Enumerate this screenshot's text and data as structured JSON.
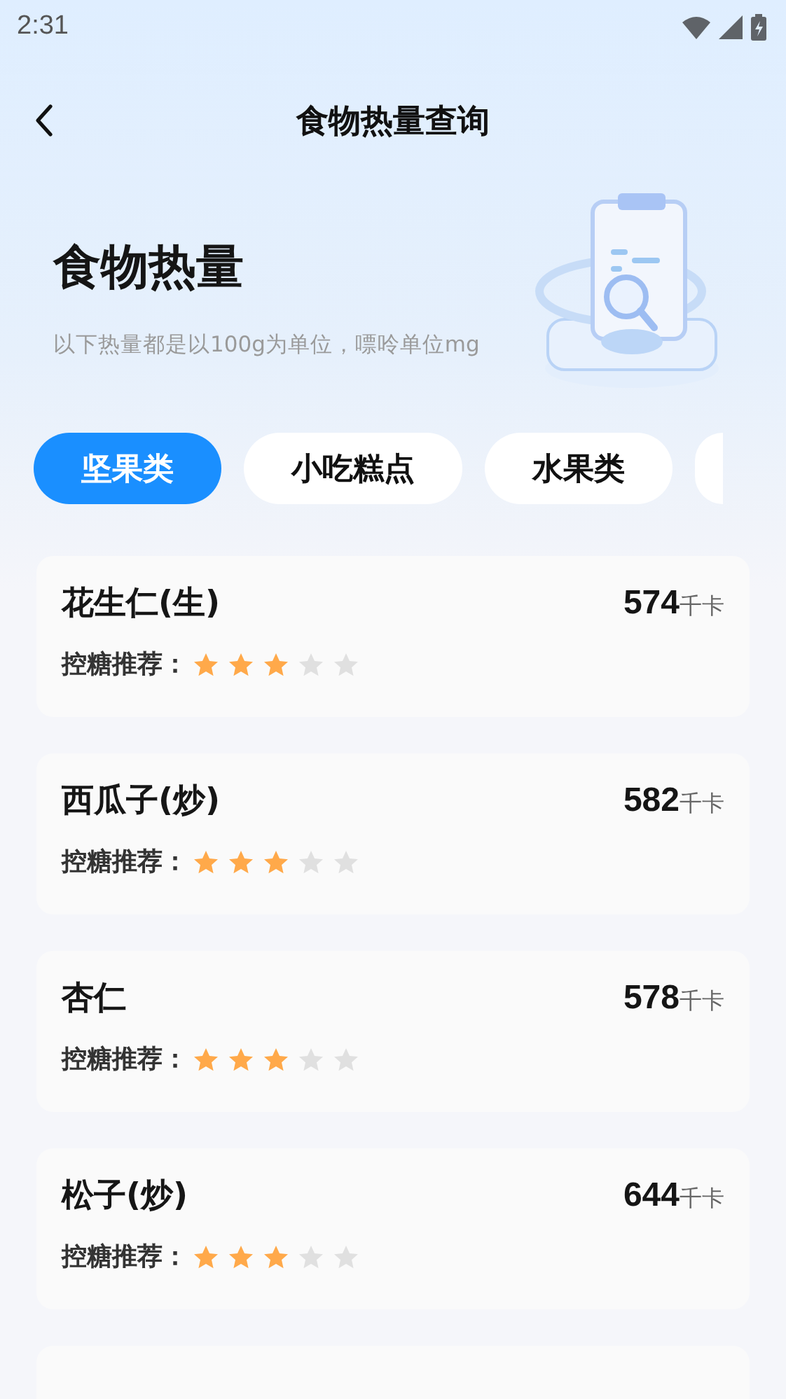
{
  "status_bar": {
    "time": "2:31"
  },
  "nav": {
    "title": "食物热量查询"
  },
  "header": {
    "title": "食物热量",
    "subtitle": "以下热量都是以100g为单位，嘌呤单位mg"
  },
  "tabs": [
    {
      "label": "坚果类",
      "selected": true
    },
    {
      "label": "小吃糕点",
      "selected": false
    },
    {
      "label": "水果类",
      "selected": false
    }
  ],
  "more_tabs_cut": true,
  "foods": [
    {
      "name": "花生仁(生)",
      "calories": "574",
      "unit": "千卡",
      "rating_label": "控糖推荐：",
      "stars": 3
    },
    {
      "name": "西瓜子(炒)",
      "calories": "582",
      "unit": "千卡",
      "rating_label": "控糖推荐：",
      "stars": 3
    },
    {
      "name": "杏仁",
      "calories": "578",
      "unit": "千卡",
      "rating_label": "控糖推荐：",
      "stars": 3
    },
    {
      "name": "松子(炒)",
      "calories": "644",
      "unit": "千卡",
      "rating_label": "控糖推荐：",
      "stars": 3
    }
  ],
  "more_cards_cut": true
}
